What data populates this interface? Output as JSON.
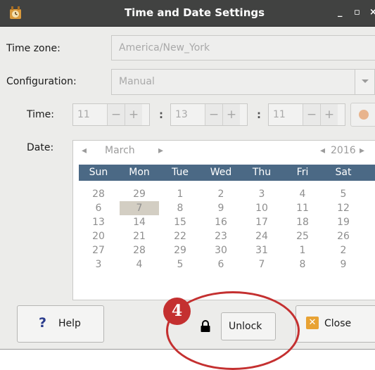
{
  "window": {
    "title": "Time and Date Settings",
    "minimize_glyph": "_",
    "maximize_glyph": "▫",
    "close_glyph": "×"
  },
  "timezone": {
    "label": "Time zone:",
    "value": "America/New_York"
  },
  "configuration": {
    "label": "Configuration:",
    "value": "Manual"
  },
  "time": {
    "label": "Time:",
    "hours": "11",
    "minutes": "13",
    "seconds": "11",
    "separator": ":",
    "minus": "−",
    "plus": "+"
  },
  "date": {
    "label": "Date:",
    "month": "March",
    "year": "2016",
    "prev_glyph": "◂",
    "next_glyph": "▸",
    "weekdays": [
      "Sun",
      "Mon",
      "Tue",
      "Wed",
      "Thu",
      "Fri",
      "Sat"
    ],
    "weeks": [
      [
        "28",
        "29",
        "1",
        "2",
        "3",
        "4",
        "5"
      ],
      [
        "6",
        "7",
        "8",
        "9",
        "10",
        "11",
        "12"
      ],
      [
        "13",
        "14",
        "15",
        "16",
        "17",
        "18",
        "19"
      ],
      [
        "20",
        "21",
        "22",
        "23",
        "24",
        "25",
        "26"
      ],
      [
        "27",
        "28",
        "29",
        "30",
        "31",
        "1",
        "2"
      ],
      [
        "3",
        "4",
        "5",
        "6",
        "7",
        "8",
        "9"
      ]
    ],
    "selected_day": "7"
  },
  "buttons": {
    "help_label": "Help",
    "help_glyph": "?",
    "unlock_label": "Unlock",
    "close_label": "Close",
    "close_glyph": "✕"
  },
  "annotation": {
    "step_number": "4"
  },
  "colors": {
    "titlebar": "#414241",
    "weekday_header": "#4b6985",
    "annotation": "#c43030"
  }
}
